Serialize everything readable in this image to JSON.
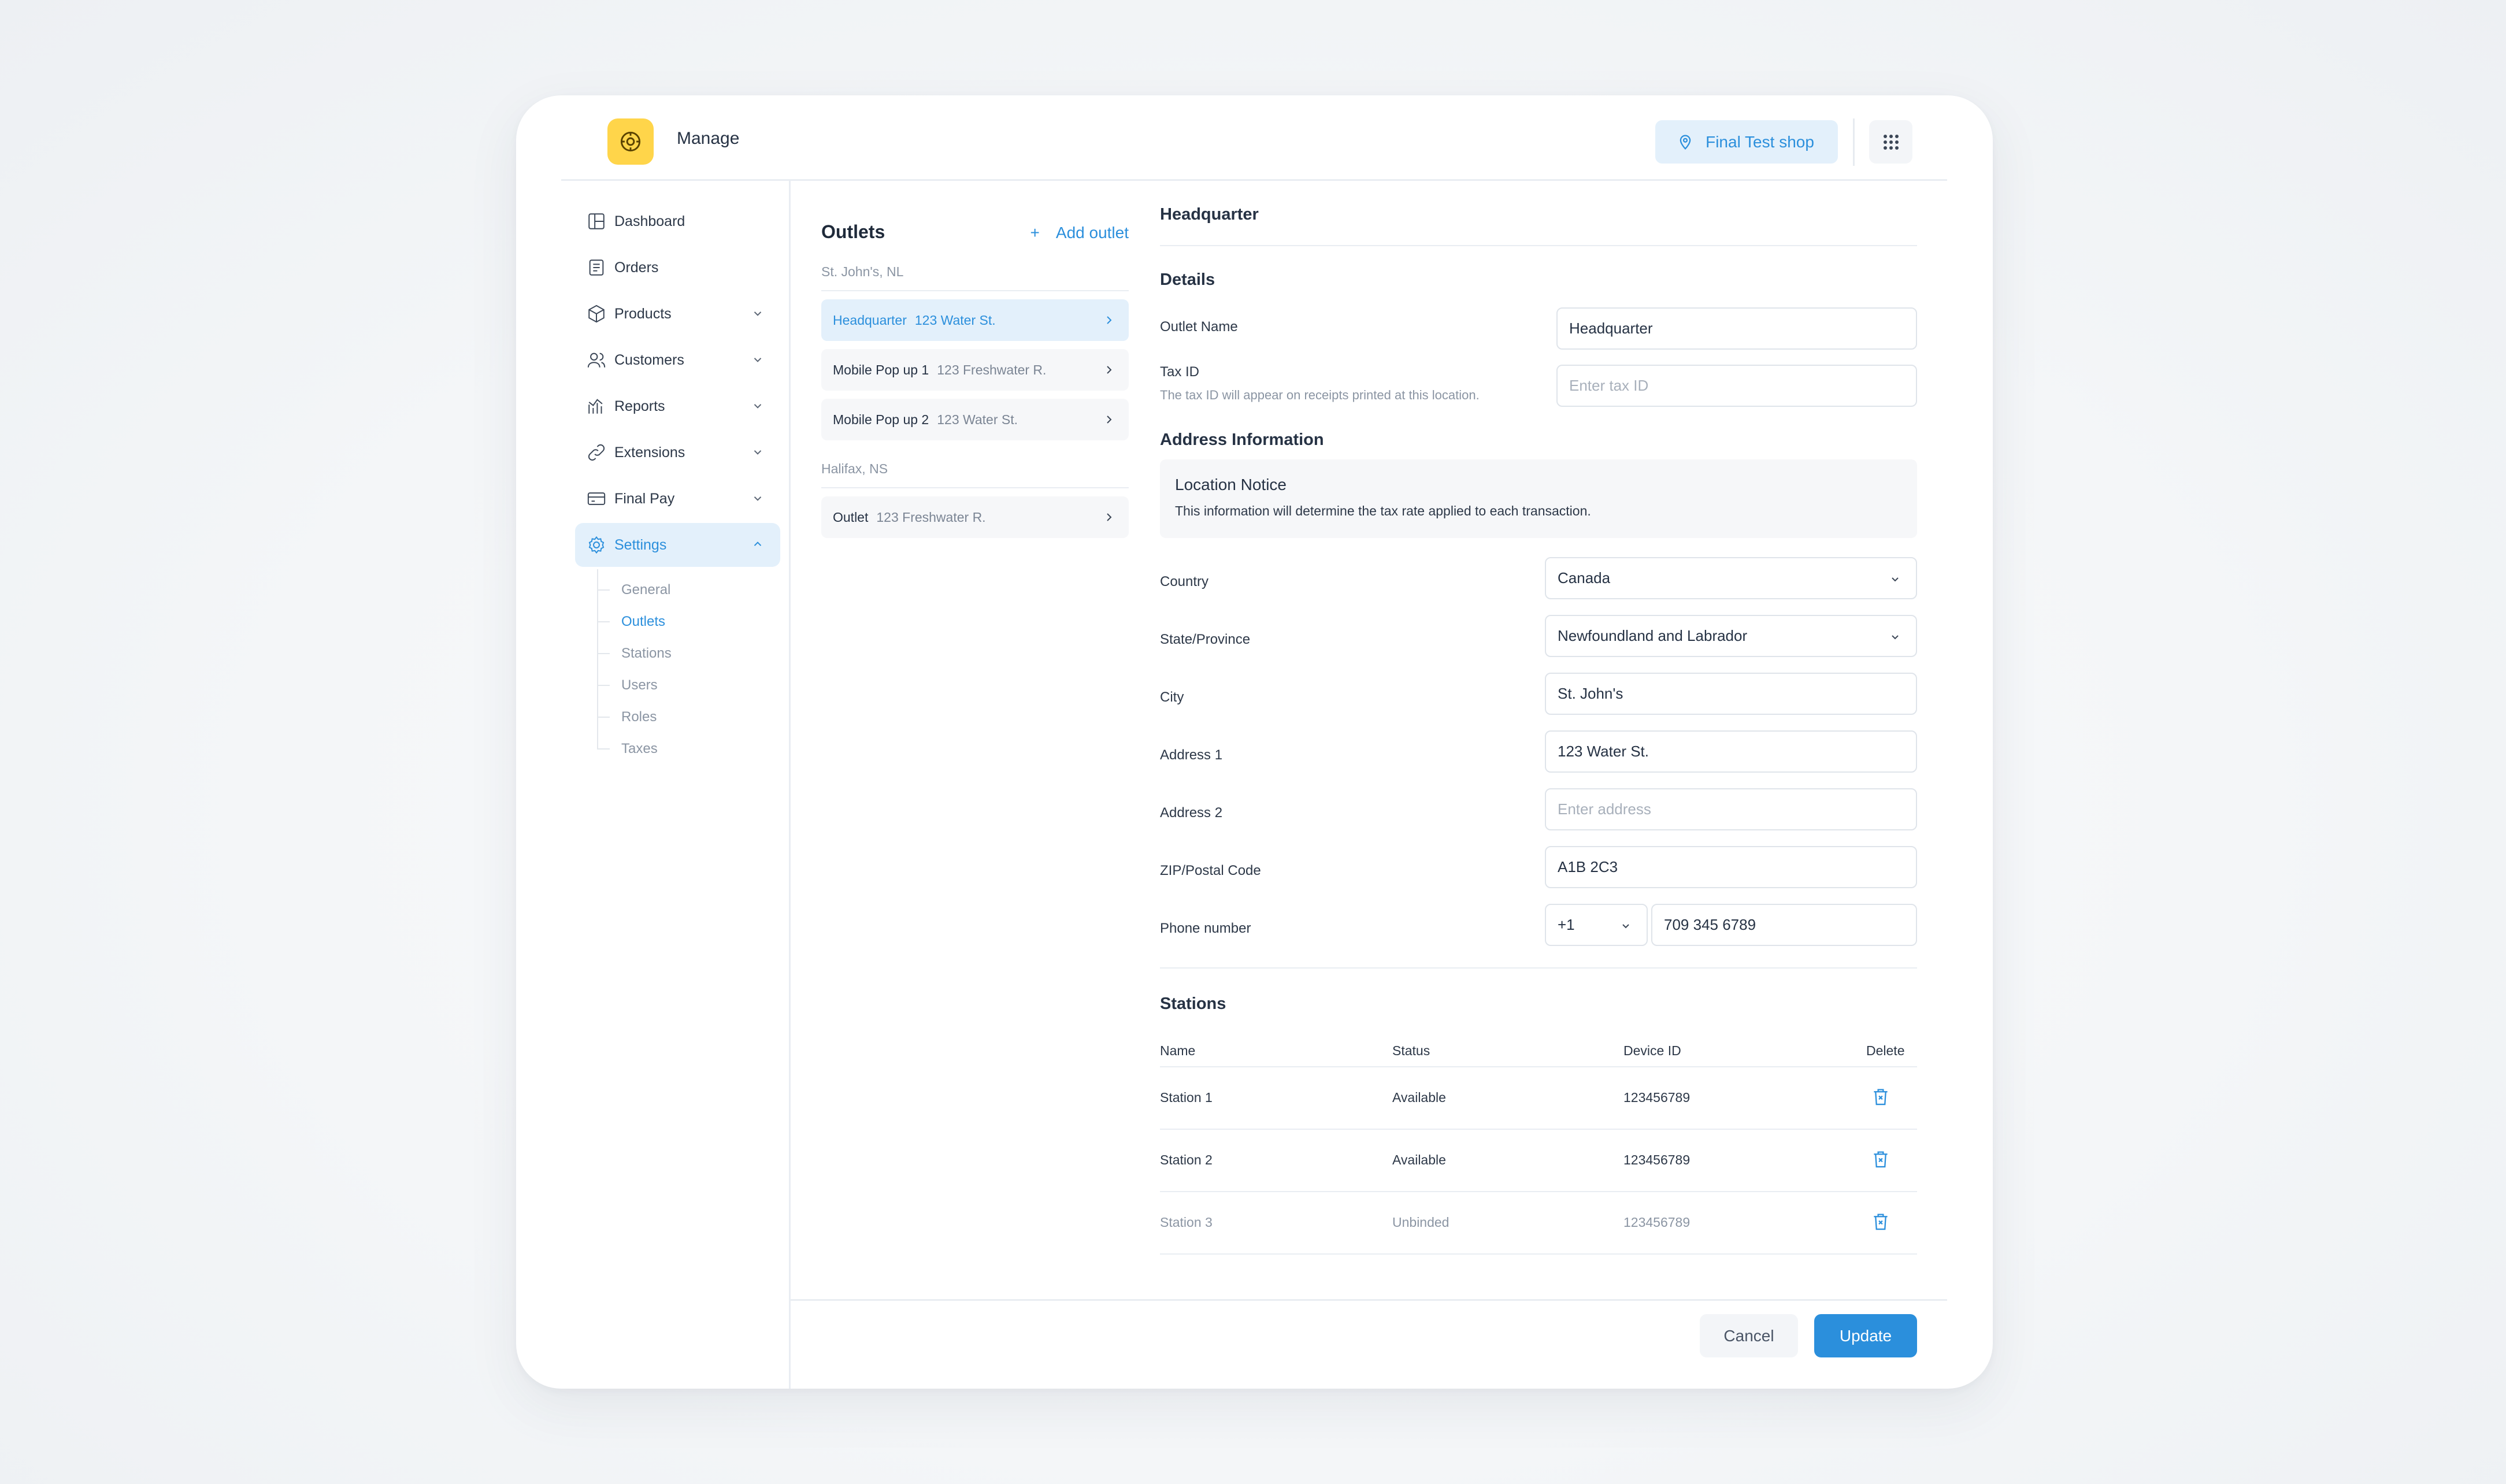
{
  "app": {
    "title": "Manage"
  },
  "header": {
    "shop_label": "Final Test shop"
  },
  "sidebar": {
    "items": [
      {
        "label": "Dashboard",
        "icon": "dashboard-icon"
      },
      {
        "label": "Orders",
        "icon": "orders-icon"
      },
      {
        "label": "Products",
        "icon": "box-icon"
      },
      {
        "label": "Customers",
        "icon": "users-icon"
      },
      {
        "label": "Reports",
        "icon": "chart-icon"
      },
      {
        "label": "Extensions",
        "icon": "link-icon"
      },
      {
        "label": "Final Pay",
        "icon": "card-icon"
      },
      {
        "label": "Settings",
        "icon": "gear-icon"
      }
    ],
    "settings_sub": [
      "General",
      "Outlets",
      "Stations",
      "Users",
      "Roles",
      "Taxes"
    ]
  },
  "outlets": {
    "title": "Outlets",
    "add_label": "Add outlet",
    "regions": [
      {
        "name": "St. John's, NL",
        "items": [
          {
            "name": "Headquarter",
            "address": "123 Water St."
          },
          {
            "name": "Mobile Pop up 1",
            "address": "123 Freshwater R."
          },
          {
            "name": "Mobile Pop up 2",
            "address": "123 Water St."
          }
        ]
      },
      {
        "name": "Halifax, NS",
        "items": [
          {
            "name": "Outlet",
            "address": "123 Freshwater R."
          }
        ]
      }
    ]
  },
  "form": {
    "heading": "Headquarter",
    "details_title": "Details",
    "outlet_name_label": "Outlet Name",
    "outlet_name_value": "Headquarter",
    "tax_id_label": "Tax ID",
    "tax_id_help": "The tax ID will appear on receipts printed at this location.",
    "tax_id_placeholder": "Enter tax ID",
    "address_title": "Address Information",
    "notice_title": "Location Notice",
    "notice_text": "This information will determine the tax rate applied to each transaction.",
    "country_label": "Country",
    "country_value": "Canada",
    "state_label": "State/Province",
    "state_value": "Newfoundland and Labrador",
    "city_label": "City",
    "city_value": "St. John's",
    "address1_label": "Address 1",
    "address1_value": "123 Water St.",
    "address2_label": "Address 2",
    "address2_placeholder": "Enter address",
    "zip_label": "ZIP/Postal Code",
    "zip_value": "A1B 2C3",
    "phone_label": "Phone number",
    "phone_code": "+1",
    "phone_value": "709 345 6789"
  },
  "stations": {
    "title": "Stations",
    "columns": [
      "Name",
      "Status",
      "Device ID",
      "Delete"
    ],
    "rows": [
      {
        "name": "Station 1",
        "status": "Available",
        "device_id": "123456789"
      },
      {
        "name": "Station 2",
        "status": "Available",
        "device_id": "123456789"
      },
      {
        "name": "Station 3",
        "status": "Unbinded",
        "device_id": "123456789"
      }
    ]
  },
  "footer": {
    "cancel_label": "Cancel",
    "update_label": "Update"
  },
  "colors": {
    "accent": "#2b8fdc",
    "accent_bg": "#e3f0fb",
    "logo_bg": "#ffd54a"
  }
}
